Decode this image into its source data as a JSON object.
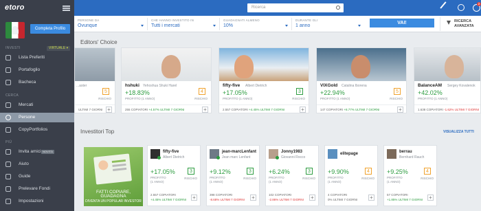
{
  "app": {
    "logo": "etoro"
  },
  "sidebar": {
    "complete_profile": "Completa Profilo",
    "section_invest": "INVESTI",
    "virtual_badge": "VIRTUALE ▾",
    "invest_items": [
      {
        "label": "Lista Preferiti",
        "icon": "star-list-icon"
      },
      {
        "label": "Portafoglio",
        "icon": "pie-chart-icon"
      },
      {
        "label": "Bacheca",
        "icon": "feed-icon"
      }
    ],
    "section_search": "CERCA",
    "search_items": [
      {
        "label": "Mercati",
        "icon": "chart-icon"
      },
      {
        "label": "Persone",
        "icon": "people-icon"
      },
      {
        "label": "CopyPortfolios",
        "icon": "portfolio-icon"
      }
    ],
    "section_more": "PIÙ",
    "more_items": [
      {
        "label": "Invita amici",
        "icon": "invite-icon",
        "badge": "NOVITÀ"
      },
      {
        "label": "Aiuto",
        "icon": "help-icon"
      },
      {
        "label": "Guide",
        "icon": "guide-icon"
      },
      {
        "label": "Prelevare Fondi",
        "icon": "withdraw-icon"
      },
      {
        "label": "Impostazioni",
        "icon": "settings-icon"
      }
    ]
  },
  "topbar": {
    "search_placeholder": "Ricerca",
    "notification_count": "2"
  },
  "filters": [
    {
      "label": "PERSONE DA",
      "value": "Ovunque"
    },
    {
      "label": "CHE HANNO INVESTITO IN",
      "value": "Tutti i mercati"
    },
    {
      "label": "GUADAGNATI ALMENO",
      "value": "10%"
    },
    {
      "label": "DURANTE GLI",
      "value": "1 anno"
    }
  ],
  "go_button": "VAI!",
  "advanced": "RICERCA\nAVANZATA",
  "editors_choice": {
    "title": "Editors' Choice",
    "cards": [
      {
        "name": "",
        "full": "...aster",
        "pct": "",
        "profit_label": "",
        "risk": "5",
        "risk_label": "RISCHIO",
        "copiers": "ULTIMI 7 GIORNI",
        "change": "",
        "trend": "up"
      },
      {
        "name": "hshuki",
        "full": "Yehoshua Shuki Harel",
        "pct": "+18.83%",
        "profit_label": "PROFITTO (1 ANNO)",
        "risk": "4",
        "risk_label": "RISCHIO",
        "copiers": "255 COPIATORI",
        "change": "+4.57% ULTIMI 7 GIORNI",
        "trend": "up"
      },
      {
        "name": "fifty-five",
        "full": "Albert Dietrich",
        "pct": "+17.05%",
        "profit_label": "PROFITTO (1 ANNO)",
        "risk": "3",
        "risk_label": "RISCHIO",
        "copiers": "2.557 COPIATORI",
        "change": "+4.45% ULTIMI 7 GIORNI",
        "trend": "up"
      },
      {
        "name": "VIXGold",
        "full": "Catalina Iborena",
        "pct": "+22.94%",
        "profit_label": "PROFITTO (1 ANNO)",
        "risk": "5",
        "risk_label": "RISCHIO",
        "copiers": "147 COPIATORI",
        "change": "+8.77% ULTIMI 7 GIORNI",
        "trend": "up"
      },
      {
        "name": "BalanceAM",
        "full": "Sergey Kovalenok",
        "pct": "+42.02%",
        "profit_label": "PROFITTO (1 ANNO)",
        "risk": "",
        "risk_label": "",
        "copiers": "1.638 COPIATORI",
        "change": "-1.62% ULTIMI 7 GIORNI",
        "trend": "down"
      }
    ]
  },
  "top_investors": {
    "title": "Investitori Top",
    "see_all": "VISUALIZZA TUTTI",
    "promo": {
      "line1": "FATTI COPIARE, GUADAGNA",
      "line2": "DIVENTA UN POPULAR INVESTOR"
    },
    "cards": [
      {
        "name": "fifty-five",
        "full": "Albert Dietrich",
        "pct": "+17.05%",
        "profit_label": "PROFITTO\n(1 ANNO)",
        "risk": "3",
        "risk_label": "RISCHIO",
        "copiers": "2.557 COPIATORI",
        "change": "+4.45% ULTIMI 7 GIORNI",
        "trend": "up"
      },
      {
        "name": "jean-marcLenfant",
        "full": "Jean marc Lenfant",
        "pct": "+9.12%",
        "profit_label": "PROFITTO\n(1 ANNO)",
        "risk": "3",
        "risk_label": "RISCHIO",
        "copiers": "398 COPIATORI",
        "change": "-8.68% ULTIMI 7 GIORNI",
        "trend": "down"
      },
      {
        "name": "Jonny1983",
        "full": "Giovanni Rocco",
        "pct": "+6.24%",
        "profit_label": "PROFITTO\n(1 ANNO)",
        "risk": "3",
        "risk_label": "RISCHIO",
        "copiers": "102 COPIATORI",
        "change": "-2.86% ULTIMI 7 GIORNI",
        "trend": "down"
      },
      {
        "name": "elitepage",
        "full": "",
        "pct": "+9.90%",
        "profit_label": "PROFITTO\n(1 ANNO)",
        "risk": "4",
        "risk_label": "RISCHIO",
        "copiers": "4 COPIATORI",
        "change": "0% ULTIMI 7 GIORNI",
        "trend": "up"
      },
      {
        "name": "berrau",
        "full": "Bernhard Rauch",
        "pct": "+9.25%",
        "profit_label": "PROFITTO\n(1 ANNO)",
        "risk": "4",
        "risk_label": "RISCHIO",
        "copiers": "57 COPIATORI",
        "change": "+1.85% ULTIMI 7 GIORNI",
        "trend": "up"
      }
    ]
  }
}
